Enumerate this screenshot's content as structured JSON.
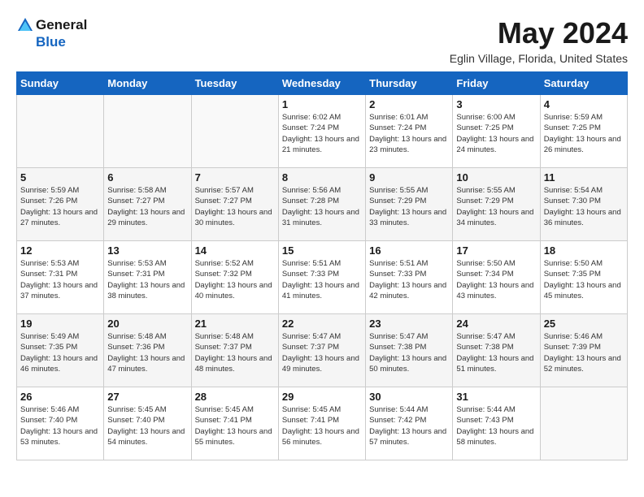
{
  "header": {
    "logo_general": "General",
    "logo_blue": "Blue",
    "month_title": "May 2024",
    "location": "Eglin Village, Florida, United States"
  },
  "days_of_week": [
    "Sunday",
    "Monday",
    "Tuesday",
    "Wednesday",
    "Thursday",
    "Friday",
    "Saturday"
  ],
  "weeks": [
    [
      {
        "day": "",
        "info": ""
      },
      {
        "day": "",
        "info": ""
      },
      {
        "day": "",
        "info": ""
      },
      {
        "day": "1",
        "info": "Sunrise: 6:02 AM\nSunset: 7:24 PM\nDaylight: 13 hours\nand 21 minutes."
      },
      {
        "day": "2",
        "info": "Sunrise: 6:01 AM\nSunset: 7:24 PM\nDaylight: 13 hours\nand 23 minutes."
      },
      {
        "day": "3",
        "info": "Sunrise: 6:00 AM\nSunset: 7:25 PM\nDaylight: 13 hours\nand 24 minutes."
      },
      {
        "day": "4",
        "info": "Sunrise: 5:59 AM\nSunset: 7:25 PM\nDaylight: 13 hours\nand 26 minutes."
      }
    ],
    [
      {
        "day": "5",
        "info": "Sunrise: 5:59 AM\nSunset: 7:26 PM\nDaylight: 13 hours\nand 27 minutes."
      },
      {
        "day": "6",
        "info": "Sunrise: 5:58 AM\nSunset: 7:27 PM\nDaylight: 13 hours\nand 29 minutes."
      },
      {
        "day": "7",
        "info": "Sunrise: 5:57 AM\nSunset: 7:27 PM\nDaylight: 13 hours\nand 30 minutes."
      },
      {
        "day": "8",
        "info": "Sunrise: 5:56 AM\nSunset: 7:28 PM\nDaylight: 13 hours\nand 31 minutes."
      },
      {
        "day": "9",
        "info": "Sunrise: 5:55 AM\nSunset: 7:29 PM\nDaylight: 13 hours\nand 33 minutes."
      },
      {
        "day": "10",
        "info": "Sunrise: 5:55 AM\nSunset: 7:29 PM\nDaylight: 13 hours\nand 34 minutes."
      },
      {
        "day": "11",
        "info": "Sunrise: 5:54 AM\nSunset: 7:30 PM\nDaylight: 13 hours\nand 36 minutes."
      }
    ],
    [
      {
        "day": "12",
        "info": "Sunrise: 5:53 AM\nSunset: 7:31 PM\nDaylight: 13 hours\nand 37 minutes."
      },
      {
        "day": "13",
        "info": "Sunrise: 5:53 AM\nSunset: 7:31 PM\nDaylight: 13 hours\nand 38 minutes."
      },
      {
        "day": "14",
        "info": "Sunrise: 5:52 AM\nSunset: 7:32 PM\nDaylight: 13 hours\nand 40 minutes."
      },
      {
        "day": "15",
        "info": "Sunrise: 5:51 AM\nSunset: 7:33 PM\nDaylight: 13 hours\nand 41 minutes."
      },
      {
        "day": "16",
        "info": "Sunrise: 5:51 AM\nSunset: 7:33 PM\nDaylight: 13 hours\nand 42 minutes."
      },
      {
        "day": "17",
        "info": "Sunrise: 5:50 AM\nSunset: 7:34 PM\nDaylight: 13 hours\nand 43 minutes."
      },
      {
        "day": "18",
        "info": "Sunrise: 5:50 AM\nSunset: 7:35 PM\nDaylight: 13 hours\nand 45 minutes."
      }
    ],
    [
      {
        "day": "19",
        "info": "Sunrise: 5:49 AM\nSunset: 7:35 PM\nDaylight: 13 hours\nand 46 minutes."
      },
      {
        "day": "20",
        "info": "Sunrise: 5:48 AM\nSunset: 7:36 PM\nDaylight: 13 hours\nand 47 minutes."
      },
      {
        "day": "21",
        "info": "Sunrise: 5:48 AM\nSunset: 7:37 PM\nDaylight: 13 hours\nand 48 minutes."
      },
      {
        "day": "22",
        "info": "Sunrise: 5:47 AM\nSunset: 7:37 PM\nDaylight: 13 hours\nand 49 minutes."
      },
      {
        "day": "23",
        "info": "Sunrise: 5:47 AM\nSunset: 7:38 PM\nDaylight: 13 hours\nand 50 minutes."
      },
      {
        "day": "24",
        "info": "Sunrise: 5:47 AM\nSunset: 7:38 PM\nDaylight: 13 hours\nand 51 minutes."
      },
      {
        "day": "25",
        "info": "Sunrise: 5:46 AM\nSunset: 7:39 PM\nDaylight: 13 hours\nand 52 minutes."
      }
    ],
    [
      {
        "day": "26",
        "info": "Sunrise: 5:46 AM\nSunset: 7:40 PM\nDaylight: 13 hours\nand 53 minutes."
      },
      {
        "day": "27",
        "info": "Sunrise: 5:45 AM\nSunset: 7:40 PM\nDaylight: 13 hours\nand 54 minutes."
      },
      {
        "day": "28",
        "info": "Sunrise: 5:45 AM\nSunset: 7:41 PM\nDaylight: 13 hours\nand 55 minutes."
      },
      {
        "day": "29",
        "info": "Sunrise: 5:45 AM\nSunset: 7:41 PM\nDaylight: 13 hours\nand 56 minutes."
      },
      {
        "day": "30",
        "info": "Sunrise: 5:44 AM\nSunset: 7:42 PM\nDaylight: 13 hours\nand 57 minutes."
      },
      {
        "day": "31",
        "info": "Sunrise: 5:44 AM\nSunset: 7:43 PM\nDaylight: 13 hours\nand 58 minutes."
      },
      {
        "day": "",
        "info": ""
      }
    ]
  ]
}
